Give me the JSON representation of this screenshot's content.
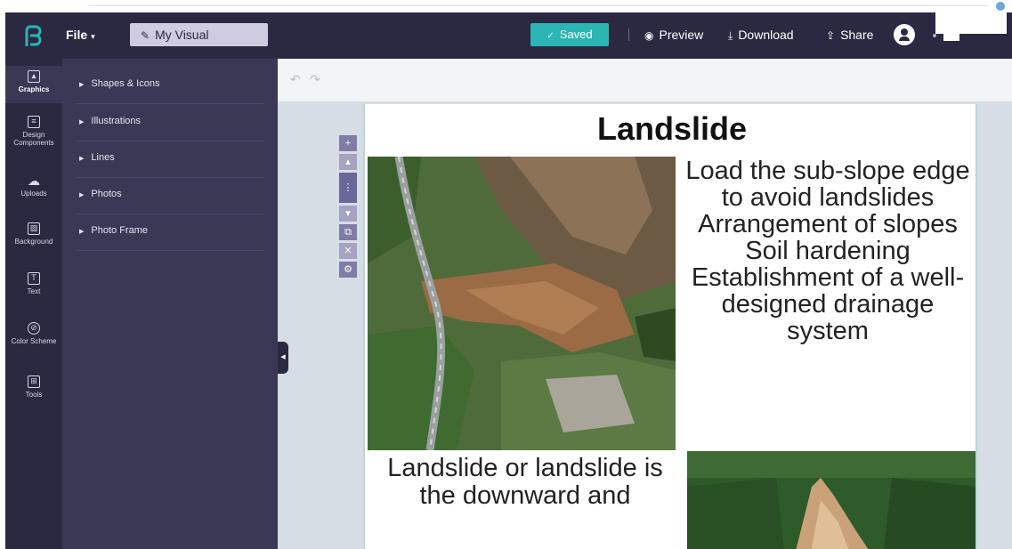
{
  "header": {
    "file_label": "File",
    "title": "My Visual",
    "saved_label": "Saved",
    "preview_label": "Preview",
    "download_label": "Download",
    "share_label": "Share"
  },
  "rail": {
    "items": [
      {
        "label": "Graphics"
      },
      {
        "label": "Design Components"
      },
      {
        "label": "Uploads"
      },
      {
        "label": "Background"
      },
      {
        "label": "Text"
      },
      {
        "label": "Color Scheme"
      },
      {
        "label": "Tools"
      }
    ]
  },
  "panel": {
    "items": [
      {
        "label": "Shapes & Icons"
      },
      {
        "label": "Illustrations"
      },
      {
        "label": "Lines"
      },
      {
        "label": "Photos"
      },
      {
        "label": "Photo Frame"
      }
    ]
  },
  "canvas": {
    "title": "Landslide",
    "right_text": "Load the sub-slope edge to avoid landslides Arrangement of slopes Soil hardening Establishment of a well-designed drainage system",
    "bottom_text": "Landslide or landslide is the downward and"
  },
  "colors": {
    "header_bg": "#2b2942",
    "panel_bg": "#3a3855",
    "accent": "#2bb5b5",
    "canvas_bg": "#d7dde5"
  }
}
